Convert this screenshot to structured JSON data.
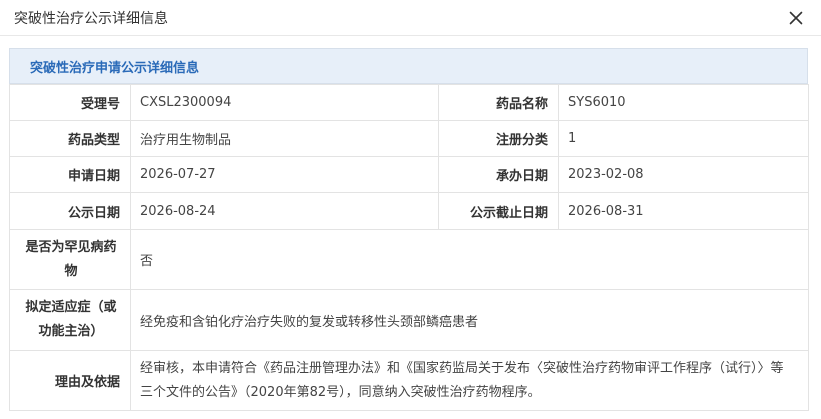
{
  "dialog": {
    "title": "突破性治疗公示详细信息",
    "close_icon": "close-icon"
  },
  "section": {
    "title": "突破性治疗申请公示详细信息"
  },
  "fields": {
    "acceptance_no": {
      "label": "受理号",
      "value": "CXSL2300094"
    },
    "drug_name": {
      "label": "药品名称",
      "value": "SYS6010"
    },
    "drug_type": {
      "label": "药品类型",
      "value": "治疗用生物制品"
    },
    "reg_class": {
      "label": "注册分类",
      "value": "1"
    },
    "apply_date": {
      "label": "申请日期",
      "value": "2026-07-27"
    },
    "handle_date": {
      "label": "承办日期",
      "value": "2023-02-08"
    },
    "publish_date": {
      "label": "公示日期",
      "value": "2026-08-24"
    },
    "publish_end_date": {
      "label": "公示截止日期",
      "value": "2026-08-31"
    },
    "rare_disease": {
      "label": "是否为罕见病药物",
      "value": "否"
    },
    "indication": {
      "label": "拟定适应症（或功能主治）",
      "value": "经免疫和含铂化疗治疗失败的复发或转移性头颈部鳞癌患者"
    },
    "reason": {
      "label": "理由及依据",
      "value": "经审核，本申请符合《药品注册管理办法》和《国家药监局关于发布〈突破性治疗药物审评工作程序（试行）〉等三个文件的公告》（2020年第82号），同意纳入突破性治疗药物程序。"
    }
  }
}
